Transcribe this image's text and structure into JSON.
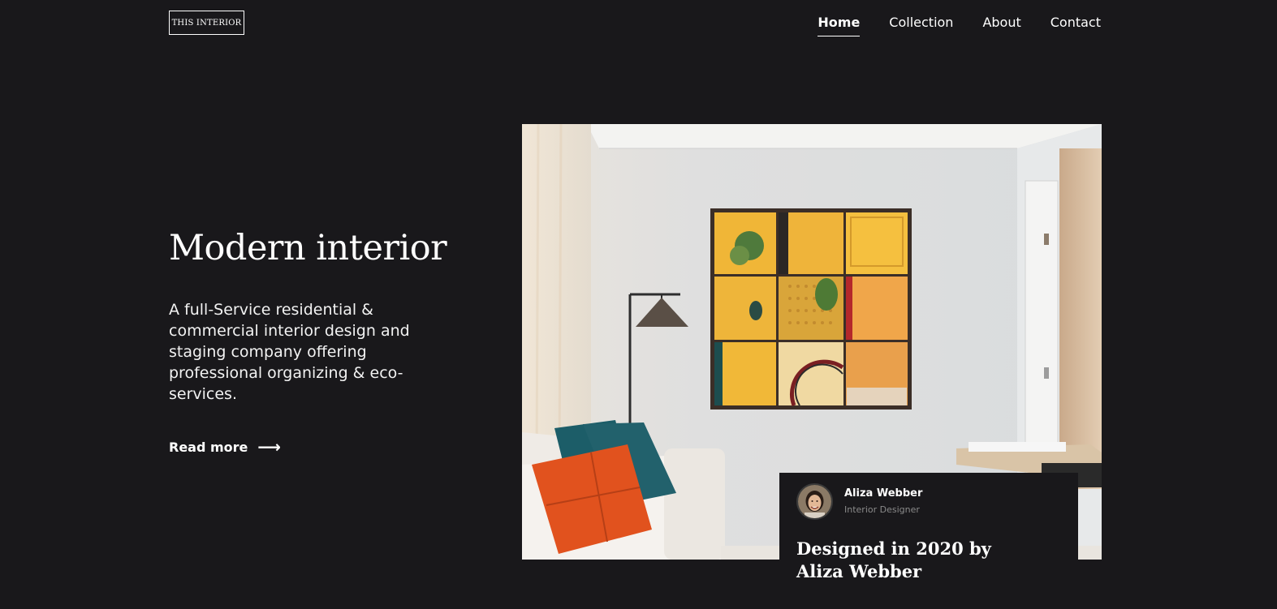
{
  "logo": {
    "text": "THIS INTERIOR"
  },
  "nav": {
    "items": [
      {
        "label": "Home",
        "active": true
      },
      {
        "label": "Collection",
        "active": false
      },
      {
        "label": "About",
        "active": false
      },
      {
        "label": "Contact",
        "active": false
      }
    ]
  },
  "hero": {
    "title": "Modern interior",
    "description": "A full-Service residential & commercial interior design and staging company offering professional organizing & eco-services.",
    "read_more_label": "Read more",
    "read_more_icon": "arrow-right-icon"
  },
  "card": {
    "name": "Aliza Webber",
    "role": "Interior Designer",
    "title": "Designed in 2020 by Aliza Webber"
  },
  "colors": {
    "background": "#19181b",
    "text": "#ffffff",
    "muted": "#8a8a8a"
  }
}
